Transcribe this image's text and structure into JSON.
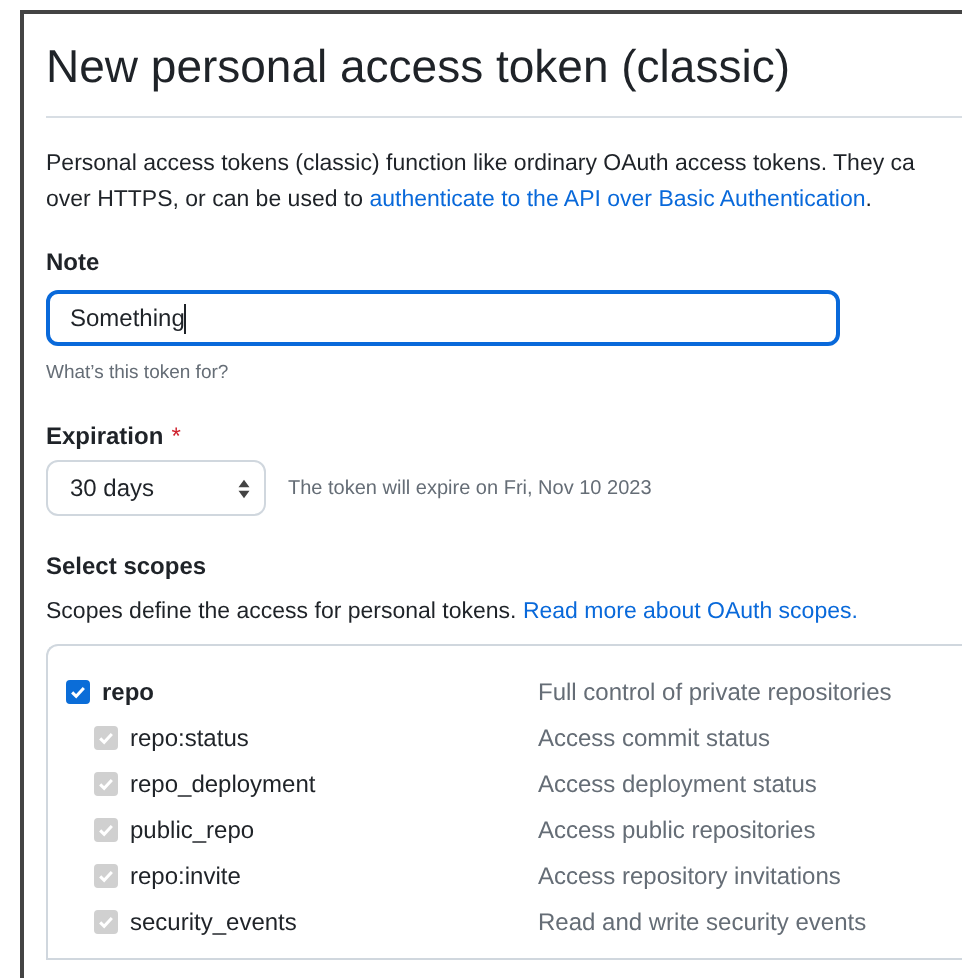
{
  "title": "New personal access token (classic)",
  "intro": {
    "lines": [
      "Personal access tokens (classic) function like ordinary OAuth access tokens. They ca",
      "over HTTPS, or can be used to "
    ],
    "link": "authenticate to the API over Basic Authentication",
    "after": "."
  },
  "note": {
    "label": "Note",
    "value": "Something",
    "hint": "What’s this token for?"
  },
  "expiration": {
    "label": "Expiration",
    "required_mark": "*",
    "value": "30 days",
    "info": "The token will expire on Fri, Nov 10 2023"
  },
  "scopes": {
    "label": "Select scopes",
    "text": "Scopes define the access for personal tokens. ",
    "link": "Read more about OAuth scopes.",
    "items": [
      {
        "name": "repo",
        "description": "Full control of private repositories",
        "checked": true,
        "disabled": false,
        "children": [
          {
            "name": "repo:status",
            "description": "Access commit status",
            "checked": true,
            "disabled": true
          },
          {
            "name": "repo_deployment",
            "description": "Access deployment status",
            "checked": true,
            "disabled": true
          },
          {
            "name": "public_repo",
            "description": "Access public repositories",
            "checked": true,
            "disabled": true
          },
          {
            "name": "repo:invite",
            "description": "Access repository invitations",
            "checked": true,
            "disabled": true
          },
          {
            "name": "security_events",
            "description": "Read and write security events",
            "checked": true,
            "disabled": true
          }
        ]
      }
    ]
  }
}
